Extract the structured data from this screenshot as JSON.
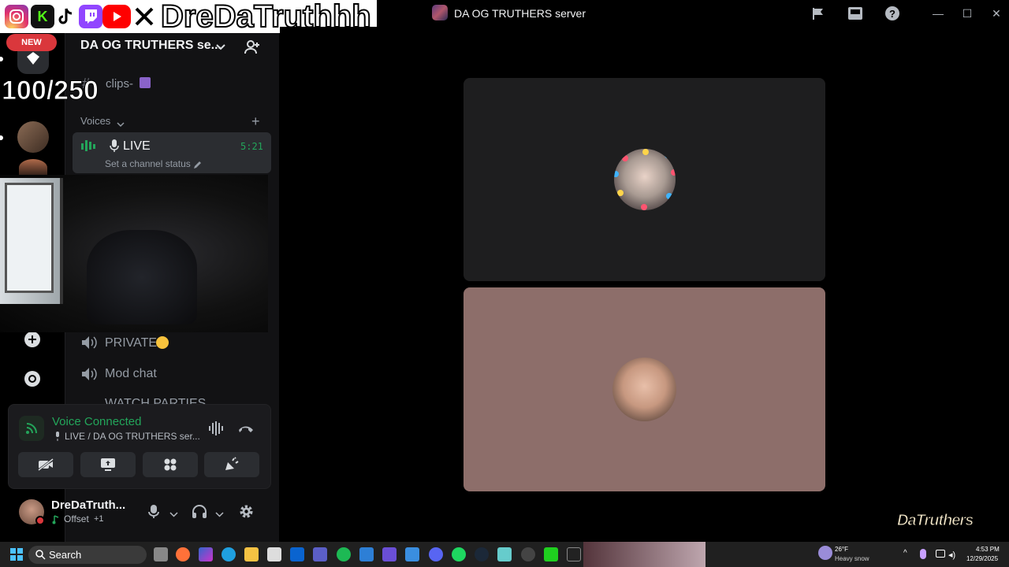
{
  "window": {
    "title": "DA OG TRUTHERS server",
    "controls": {
      "minimize": "—",
      "maximize": "☐",
      "close": "✕"
    }
  },
  "overlay": {
    "handle": "DreDaTruthhh",
    "new_badge": "NEW",
    "counter": "100/250",
    "social_icons": [
      "instagram-icon",
      "kick-icon",
      "tiktok-icon",
      "twitch-icon",
      "youtube-icon",
      "x-icon"
    ],
    "logo_text": "DaTruthers"
  },
  "sidebar": {
    "server_name": "DA OG TRUTHERS se...",
    "text_channel": "clips-",
    "category": "Voices",
    "live_channel": {
      "name": "LIVE",
      "time": "5:21",
      "status": "Set a channel status"
    },
    "channels": [
      "PRIVATE",
      "Mod chat",
      "WATCH PARTIES"
    ]
  },
  "voice": {
    "status": "Voice Connected",
    "location": "LIVE / DA OG TRUTHERS ser..."
  },
  "user": {
    "name": "DreDaTruth...",
    "activity": "Offset",
    "activity_extra": "+1"
  },
  "taskbar": {
    "search_label": "Search",
    "weather_temp": "26°F",
    "weather_desc": "Heavy snow",
    "time": "4:53 PM",
    "date": "12/29/2025"
  },
  "colors": {
    "accent_green": "#23a55a",
    "danger": "#da373c",
    "tile_bottom": "#8d6e6a"
  }
}
